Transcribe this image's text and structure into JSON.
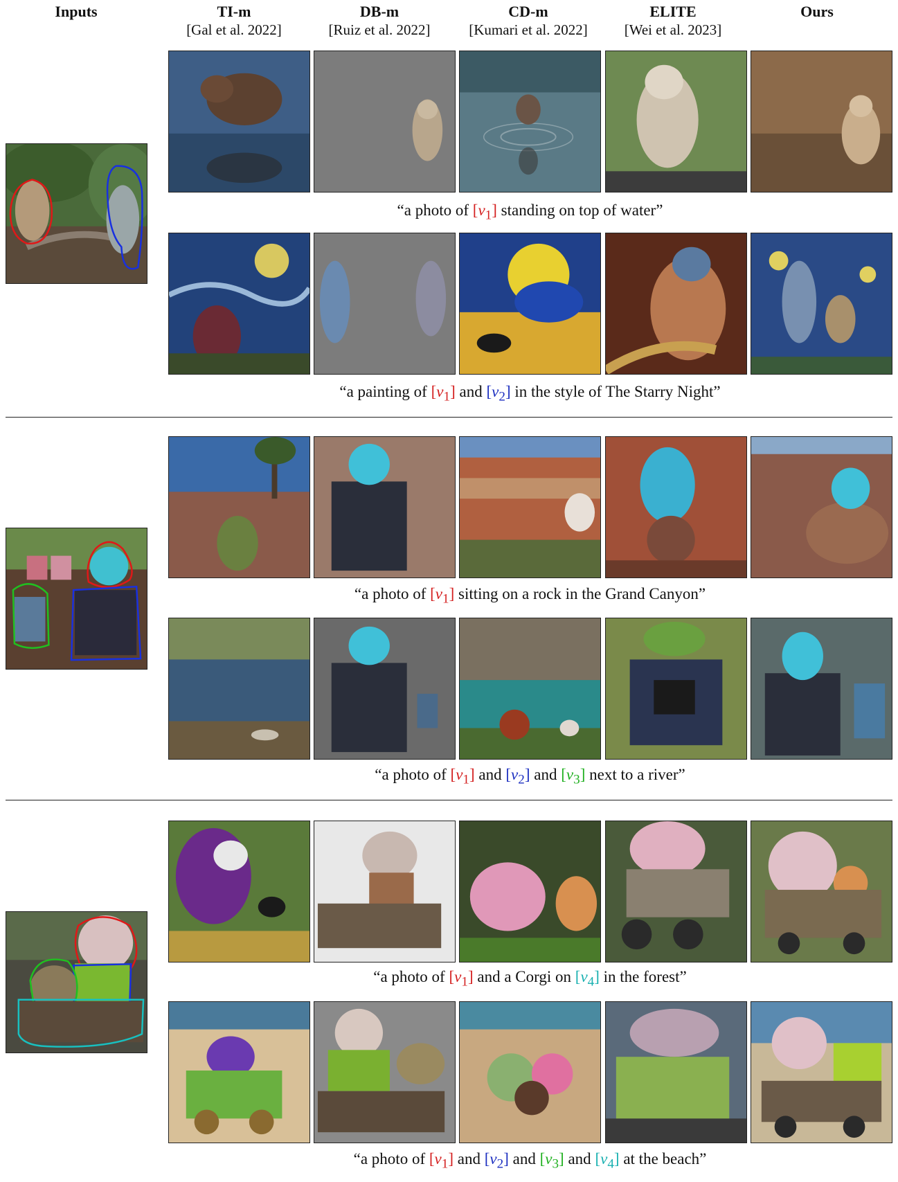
{
  "headers": {
    "inputs": "Inputs",
    "columns": [
      {
        "name": "TI-m",
        "cite": "[Gal et al. 2022]"
      },
      {
        "name": "DB-m",
        "cite": "[Ruiz et al. 2022]"
      },
      {
        "name": "CD-m",
        "cite": "[Kumari et al. 2022]"
      },
      {
        "name": "ELITE",
        "cite": "[Wei et al. 2023]"
      },
      {
        "name": "Ours",
        "cite": ""
      }
    ]
  },
  "tokens": {
    "v1": "v",
    "s1": "1",
    "v2": "v",
    "s2": "2",
    "v3": "v",
    "s3": "3",
    "v4": "v",
    "s4": "4"
  },
  "captions": {
    "c1": {
      "pre": "“a photo of ",
      "post": " standing on top of water”"
    },
    "c2": {
      "pre": "“a painting of ",
      "mid1": " and ",
      "post": " in the style of The Starry Night”"
    },
    "c3": {
      "pre": "“a photo of ",
      "post": " sitting on a rock in the Grand Canyon”"
    },
    "c4": {
      "pre": "“a photo of ",
      "mid1": " and ",
      "mid2": " and ",
      "post": " next to a river”"
    },
    "c5": {
      "pre": "“a photo of ",
      "mid1": " and a Corgi on ",
      "post": " in the forest”"
    },
    "c6": {
      "pre": "“a photo of ",
      "mid1": " and ",
      "mid2": " and ",
      "mid3": " and ",
      "post": " at the beach”"
    }
  },
  "colors": {
    "v1": "#d42020",
    "v2": "#1c2fc0",
    "v3": "#20b020",
    "v4": "#18b0b0"
  }
}
